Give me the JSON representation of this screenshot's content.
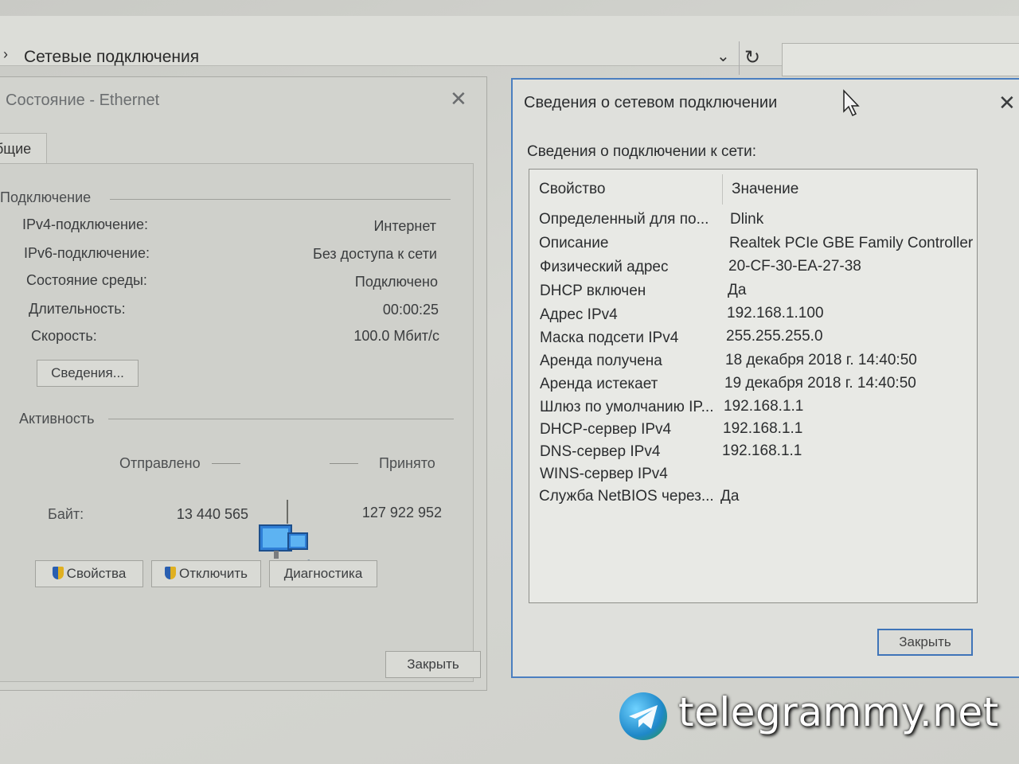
{
  "explorer": {
    "address_text": "Сетевые подключения"
  },
  "status_window": {
    "title": "Состояние - Ethernet",
    "tab_general": "бщие",
    "connection_group": "Подключение",
    "rows": [
      {
        "label": "IPv4-подключение:",
        "value": "Интернет"
      },
      {
        "label": "IPv6-подключение:",
        "value": "Без доступа к сети"
      },
      {
        "label": "Состояние среды:",
        "value": "Подключено"
      },
      {
        "label": "Длительность:",
        "value": "00:00:25"
      },
      {
        "label": "Скорость:",
        "value": "100.0 Мбит/с"
      }
    ],
    "details_button": "Сведения...",
    "activity_group": "Активность",
    "sent_label": "Отправлено",
    "received_label": "Принято",
    "bytes_label": "Байт:",
    "bytes_sent": "13 440 565",
    "bytes_received": "127 922 952",
    "properties_button": "Свойства",
    "disable_button": "Отключить",
    "diagnose_button": "Диагностика",
    "close_button": "Закрыть"
  },
  "details_window": {
    "title": "Сведения о сетевом подключении",
    "subtitle": "Сведения о подключении к сети:",
    "col_property": "Свойство",
    "col_value": "Значение",
    "rows": [
      {
        "property": "Определенный для по...",
        "value": "Dlink"
      },
      {
        "property": "Описание",
        "value": "Realtek PCIe GBE Family Controller"
      },
      {
        "property": "Физический адрес",
        "value": "20-CF-30-EA-27-38"
      },
      {
        "property": "DHCP включен",
        "value": "Да"
      },
      {
        "property": "Адрес IPv4",
        "value": "192.168.1.100"
      },
      {
        "property": "Маска подсети IPv4",
        "value": "255.255.255.0"
      },
      {
        "property": "Аренда получена",
        "value": "18 декабря 2018 г. 14:40:50"
      },
      {
        "property": "Аренда истекает",
        "value": "19 декабря 2018 г. 14:40:50"
      },
      {
        "property": "Шлюз по умолчанию IP...",
        "value": "192.168.1.1"
      },
      {
        "property": "DHCP-сервер IPv4",
        "value": "192.168.1.1"
      },
      {
        "property": "DNS-сервер IPv4",
        "value": "192.168.1.1"
      },
      {
        "property": "WINS-сервер IPv4",
        "value": ""
      },
      {
        "property": "Служба NetBIOS через...",
        "value": "Да"
      }
    ],
    "close_button": "Закрыть"
  },
  "watermark": {
    "text": "telegrammy.net"
  },
  "colors": {
    "accent_border": "#4b7fc0"
  }
}
